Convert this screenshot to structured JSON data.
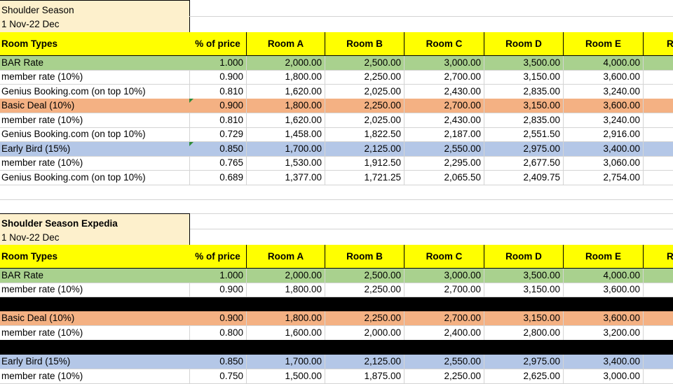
{
  "colors": {
    "title_fill": "#fdf0cc",
    "header_fill": "#ffff00",
    "bar_rate_fill": "#a9d18e",
    "basic_deal_fill": "#f4b183",
    "early_bird_fill": "#b4c7e7"
  },
  "section1": {
    "title": "Shoulder Season",
    "date_range": "1 Nov-22 Dec",
    "headers": [
      "Room Types",
      "% of price",
      "Room A",
      "Room B",
      "Room C",
      "Room D",
      "Room E",
      "R"
    ],
    "rows": [
      {
        "label": "BAR Rate",
        "pct": "1.000",
        "a": "2,000.00",
        "b": "2,500.00",
        "c": "3,000.00",
        "d": "3,500.00",
        "e": "4,000.00"
      },
      {
        "label": "member rate (10%)",
        "pct": "0.900",
        "a": "1,800.00",
        "b": "2,250.00",
        "c": "2,700.00",
        "d": "3,150.00",
        "e": "3,600.00"
      },
      {
        "label": "Genius Booking.com (on top 10%)",
        "pct": "0.810",
        "a": "1,620.00",
        "b": "2,025.00",
        "c": "2,430.00",
        "d": "2,835.00",
        "e": "3,240.00"
      },
      {
        "label": "Basic Deal (10%)",
        "pct": "0.900",
        "a": "1,800.00",
        "b": "2,250.00",
        "c": "2,700.00",
        "d": "3,150.00",
        "e": "3,600.00"
      },
      {
        "label": "member rate (10%)",
        "pct": "0.810",
        "a": "1,620.00",
        "b": "2,025.00",
        "c": "2,430.00",
        "d": "2,835.00",
        "e": "3,240.00"
      },
      {
        "label": "Genius Booking.com (on top 10%)",
        "pct": "0.729",
        "a": "1,458.00",
        "b": "1,822.50",
        "c": "2,187.00",
        "d": "2,551.50",
        "e": "2,916.00"
      },
      {
        "label": "Early Bird (15%)",
        "pct": "0.850",
        "a": "1,700.00",
        "b": "2,125.00",
        "c": "2,550.00",
        "d": "2,975.00",
        "e": "3,400.00"
      },
      {
        "label": "member rate (10%)",
        "pct": "0.765",
        "a": "1,530.00",
        "b": "1,912.50",
        "c": "2,295.00",
        "d": "2,677.50",
        "e": "3,060.00"
      },
      {
        "label": "Genius Booking.com (on top 10%)",
        "pct": "0.689",
        "a": "1,377.00",
        "b": "1,721.25",
        "c": "2,065.50",
        "d": "2,409.75",
        "e": "2,754.00"
      }
    ]
  },
  "section2": {
    "title": "Shoulder Season Expedia",
    "date_range": "1 Nov-22 Dec",
    "headers": [
      "Room Types",
      "% of price",
      "Room A",
      "Room B",
      "Room C",
      "Room D",
      "Room E",
      "R"
    ],
    "rows": [
      {
        "label": "BAR Rate",
        "pct": "1.000",
        "a": "2,000.00",
        "b": "2,500.00",
        "c": "3,000.00",
        "d": "3,500.00",
        "e": "4,000.00"
      },
      {
        "label": "member rate (10%)",
        "pct": "0.900",
        "a": "1,800.00",
        "b": "2,250.00",
        "c": "2,700.00",
        "d": "3,150.00",
        "e": "3,600.00"
      },
      {
        "label": "Basic Deal (10%)",
        "pct": "0.900",
        "a": "1,800.00",
        "b": "2,250.00",
        "c": "2,700.00",
        "d": "3,150.00",
        "e": "3,600.00"
      },
      {
        "label": "member rate (10%)",
        "pct": "0.800",
        "a": "1,600.00",
        "b": "2,000.00",
        "c": "2,400.00",
        "d": "2,800.00",
        "e": "3,200.00"
      },
      {
        "label": "Early Bird (15%)",
        "pct": "0.850",
        "a": "1,700.00",
        "b": "2,125.00",
        "c": "2,550.00",
        "d": "2,975.00",
        "e": "3,400.00"
      },
      {
        "label": "member rate (10%)",
        "pct": "0.750",
        "a": "1,500.00",
        "b": "1,875.00",
        "c": "2,250.00",
        "d": "2,625.00",
        "e": "3,000.00"
      }
    ]
  }
}
